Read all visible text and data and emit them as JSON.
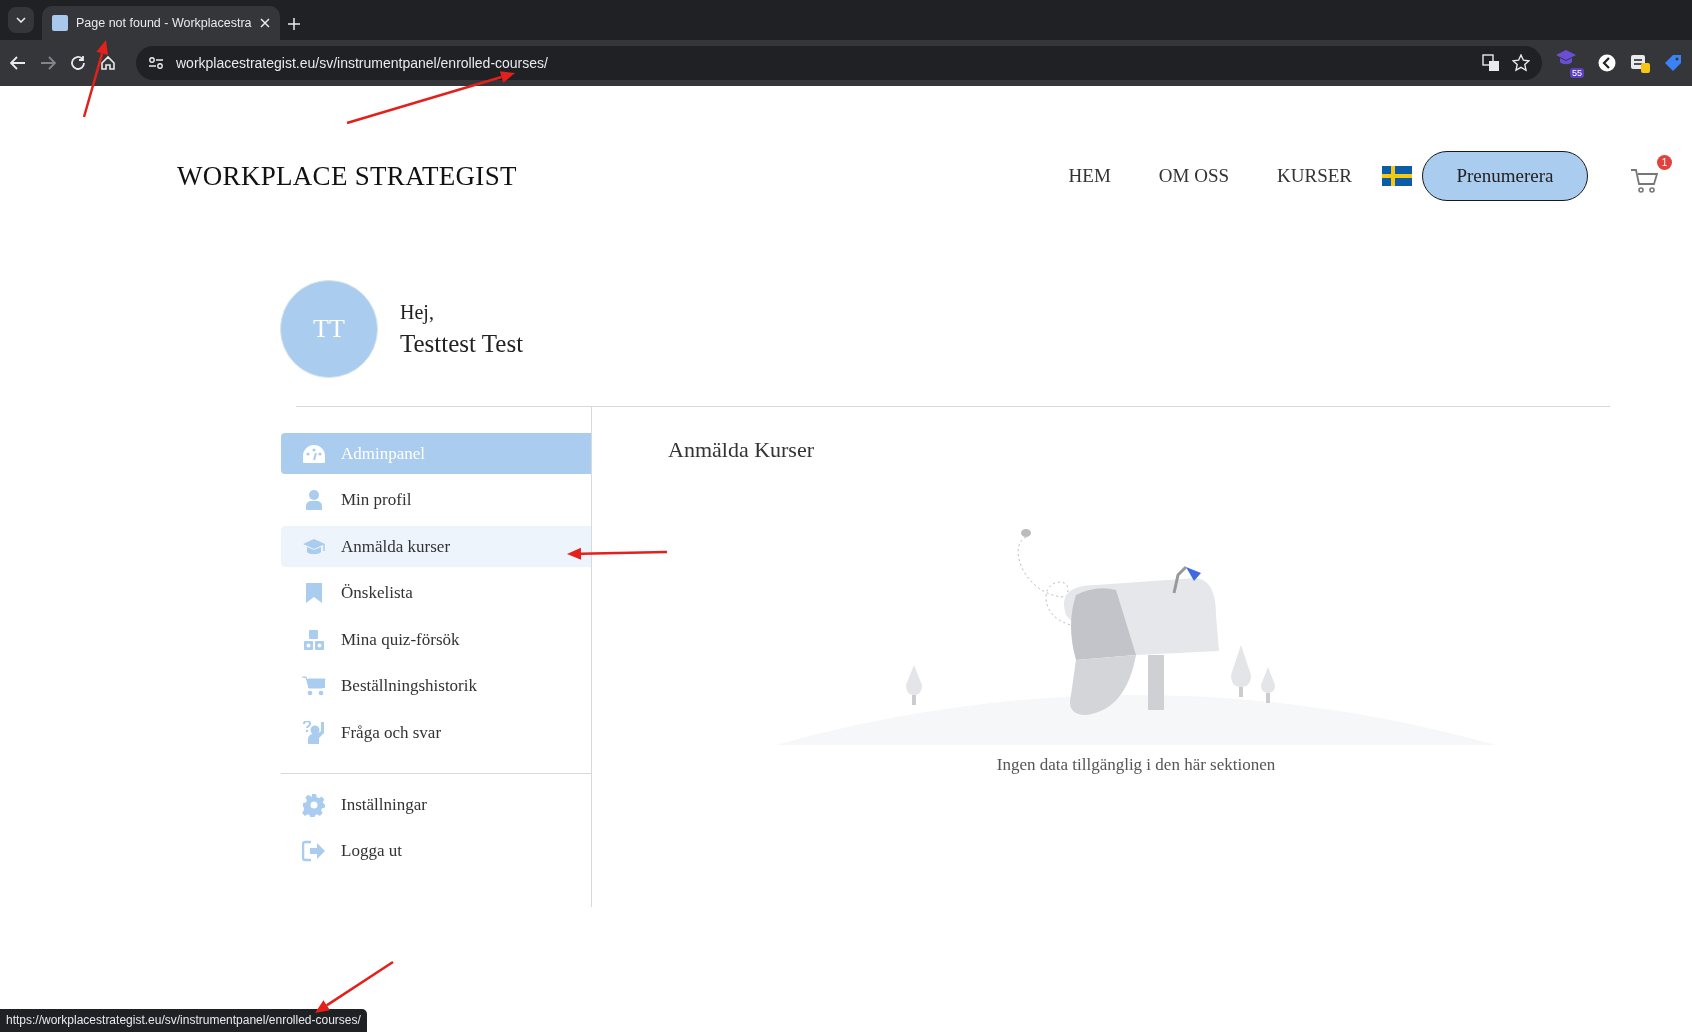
{
  "browser": {
    "tab": {
      "title": "Page not found - Workplacestra",
      "selected": true
    },
    "url": "workplacestrategist.eu/sv/instrumentpanel/enrolled-courses/",
    "extension_badge": "55"
  },
  "header": {
    "logo": "WORKPLACE STRATEGIST",
    "nav": [
      "HEM",
      "OM OSS",
      "KURSER"
    ],
    "subscribe_button": "Prenumerera",
    "cart_count": "1"
  },
  "profile": {
    "initials": "TT",
    "greeting": "Hej,",
    "name": "Testtest Test"
  },
  "sidebar": {
    "items": [
      {
        "label": "Adminpanel",
        "selected": true,
        "hovered": false
      },
      {
        "label": "Min profil",
        "selected": false,
        "hovered": false
      },
      {
        "label": "Anmälda kurser",
        "selected": false,
        "hovered": true
      },
      {
        "label": "Önskelista",
        "selected": false,
        "hovered": false
      },
      {
        "label": "Mina quiz-försök",
        "selected": false,
        "hovered": false
      },
      {
        "label": "Beställningshistorik",
        "selected": false,
        "hovered": false
      },
      {
        "label": "Fråga och svar",
        "selected": false,
        "hovered": false
      }
    ],
    "bottom_items": [
      {
        "label": "Inställningar",
        "selected": false,
        "hovered": false
      },
      {
        "label": "Logga ut",
        "selected": false,
        "hovered": false
      }
    ]
  },
  "content": {
    "title": "Anmälda Kurser",
    "empty_message": "Ingen data tillgänglig i den här sektionen"
  },
  "status_bar": {
    "link_url": "https://workplacestrategist.eu/sv/instrumentpanel/enrolled-courses/"
  }
}
